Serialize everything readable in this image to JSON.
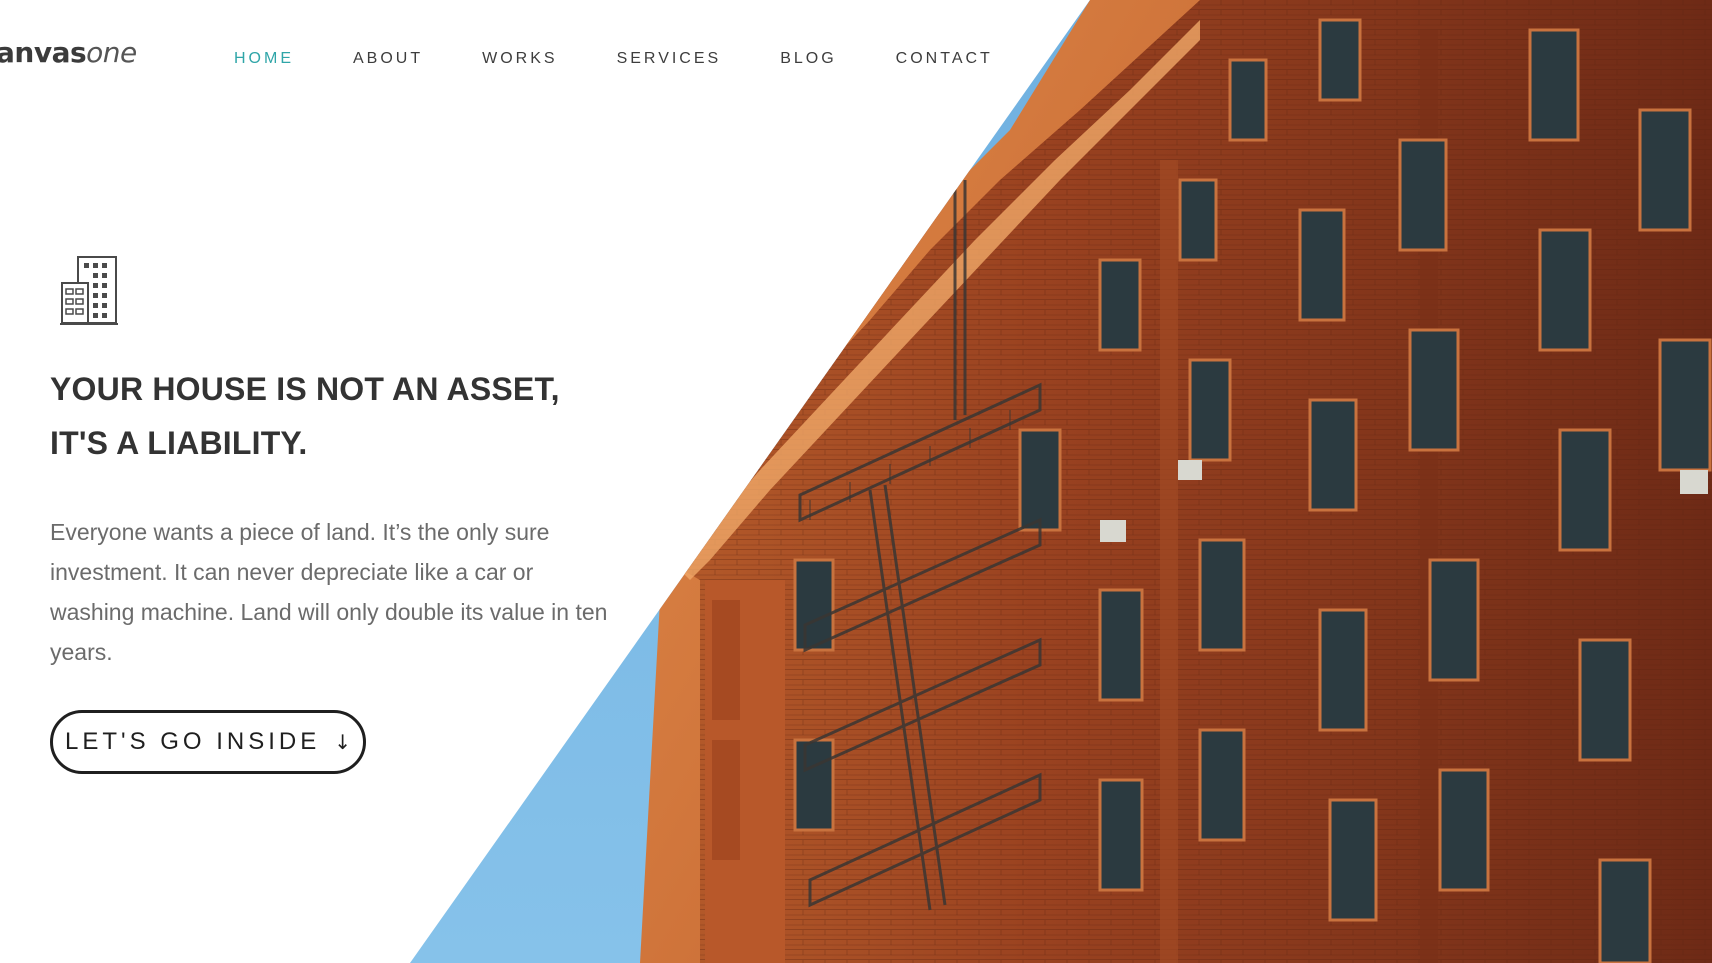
{
  "header": {
    "logo_strong": "anvas",
    "logo_light": "one",
    "nav": [
      {
        "label": "HOME",
        "active": true
      },
      {
        "label": "ABOUT",
        "active": false
      },
      {
        "label": "WORKS",
        "active": false
      },
      {
        "label": "SERVICES",
        "active": false
      },
      {
        "label": "BLOG",
        "active": false
      },
      {
        "label": "CONTACT",
        "active": false
      }
    ]
  },
  "hero": {
    "icon": "building-icon",
    "headline_line1": "YOUR HOUSE IS NOT AN ASSET,",
    "headline_line2": "IT'S A LIABILITY.",
    "body": "Everyone wants a piece of land. It’s the only sure investment. It can never depreciate like a car or washing machine. Land will only double its value in ten years.",
    "cta_label": "LET'S GO INSIDE",
    "cta_icon": "arrow-down-icon",
    "cta_arrow": "↓"
  },
  "colors": {
    "accent": "#2fa5a8",
    "text_dark": "#333333",
    "text_body": "#6b6b6b",
    "sky": "#7db8e2",
    "brick": "#8c3a1c",
    "brick_light": "#c4622c",
    "window": "#2c3a3f"
  }
}
